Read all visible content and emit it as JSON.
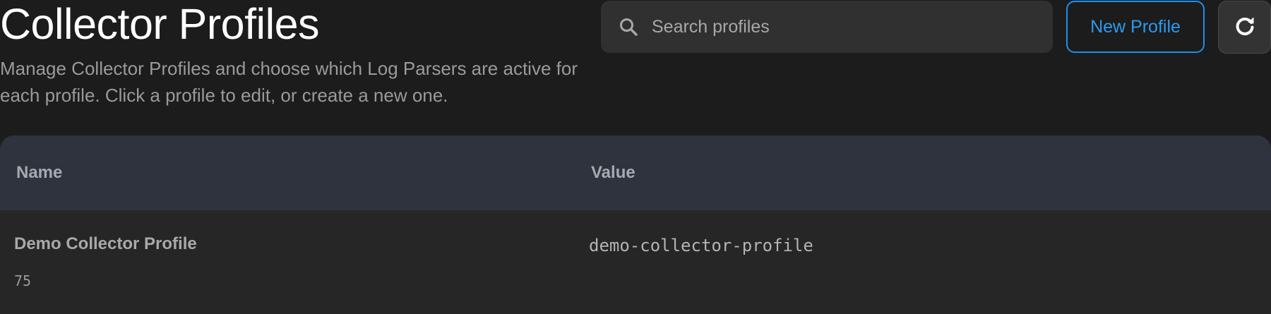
{
  "header": {
    "title": "Collector Profiles",
    "subtitle": "Manage Collector Profiles and choose which Log Parsers are active for each profile. Click a profile to edit, or create a new one."
  },
  "search": {
    "placeholder": "Search profiles",
    "value": "",
    "icon": "search-icon"
  },
  "toolbar": {
    "new_profile_label": "New Profile",
    "refresh_icon": "refresh-icon",
    "accent_color": "#1f8fe8"
  },
  "table": {
    "columns": [
      "Name",
      "Value"
    ],
    "rows": [
      {
        "name": "Demo Collector Profile",
        "id": "75",
        "value": "demo-collector-profile"
      }
    ]
  }
}
